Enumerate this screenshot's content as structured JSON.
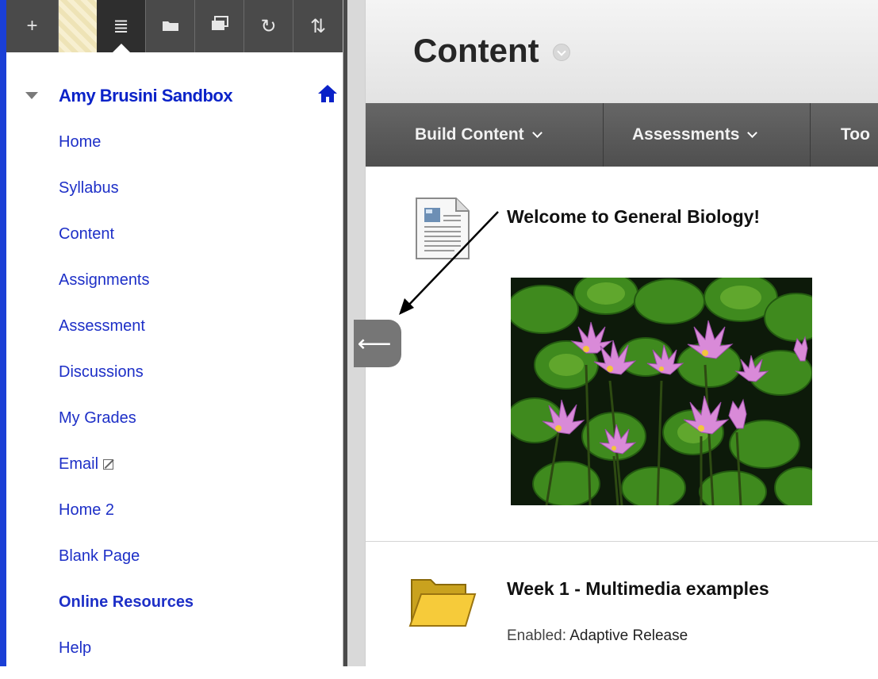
{
  "toolbar": {
    "buttons": [
      {
        "icon": "plus-icon",
        "glyph": "+"
      },
      {
        "icon": "list-icon",
        "glyph": "≣"
      },
      {
        "icon": "folder-icon",
        "glyph": "▬"
      },
      {
        "icon": "windows-icon",
        "glyph": "▣"
      },
      {
        "icon": "refresh-icon",
        "glyph": "↻"
      },
      {
        "icon": "sort-icon",
        "glyph": "⇅"
      }
    ]
  },
  "course": {
    "title": "Amy Brusini Sandbox",
    "home_icon": "house-icon"
  },
  "sidebar": {
    "items": [
      {
        "label": "Home"
      },
      {
        "label": "Syllabus"
      },
      {
        "label": "Content"
      },
      {
        "label": "Assignments"
      },
      {
        "label": "Assessment"
      },
      {
        "label": "Discussions"
      },
      {
        "label": "My Grades"
      },
      {
        "label": "Email"
      },
      {
        "label": "Home 2"
      },
      {
        "label": "Blank Page"
      },
      {
        "label": "Online Resources"
      },
      {
        "label": "Help"
      }
    ]
  },
  "splitter": {
    "handle_glyph": "⟵"
  },
  "page": {
    "title": "Content"
  },
  "action_bar": {
    "items": [
      {
        "label": "Build Content"
      },
      {
        "label": "Assessments"
      },
      {
        "label": "Too"
      }
    ]
  },
  "items": [
    {
      "title": "Welcome to General Biology!",
      "icon": "document-icon"
    },
    {
      "title": "Week 1 - Multimedia examples",
      "icon": "folder-icon",
      "meta_label": "Enabled:",
      "meta_value": "Adaptive Release"
    }
  ],
  "colors": {
    "link_blue": "#1d2fc7",
    "sidebar_edge": "#1a3fd6",
    "action_bar": "#555555"
  }
}
